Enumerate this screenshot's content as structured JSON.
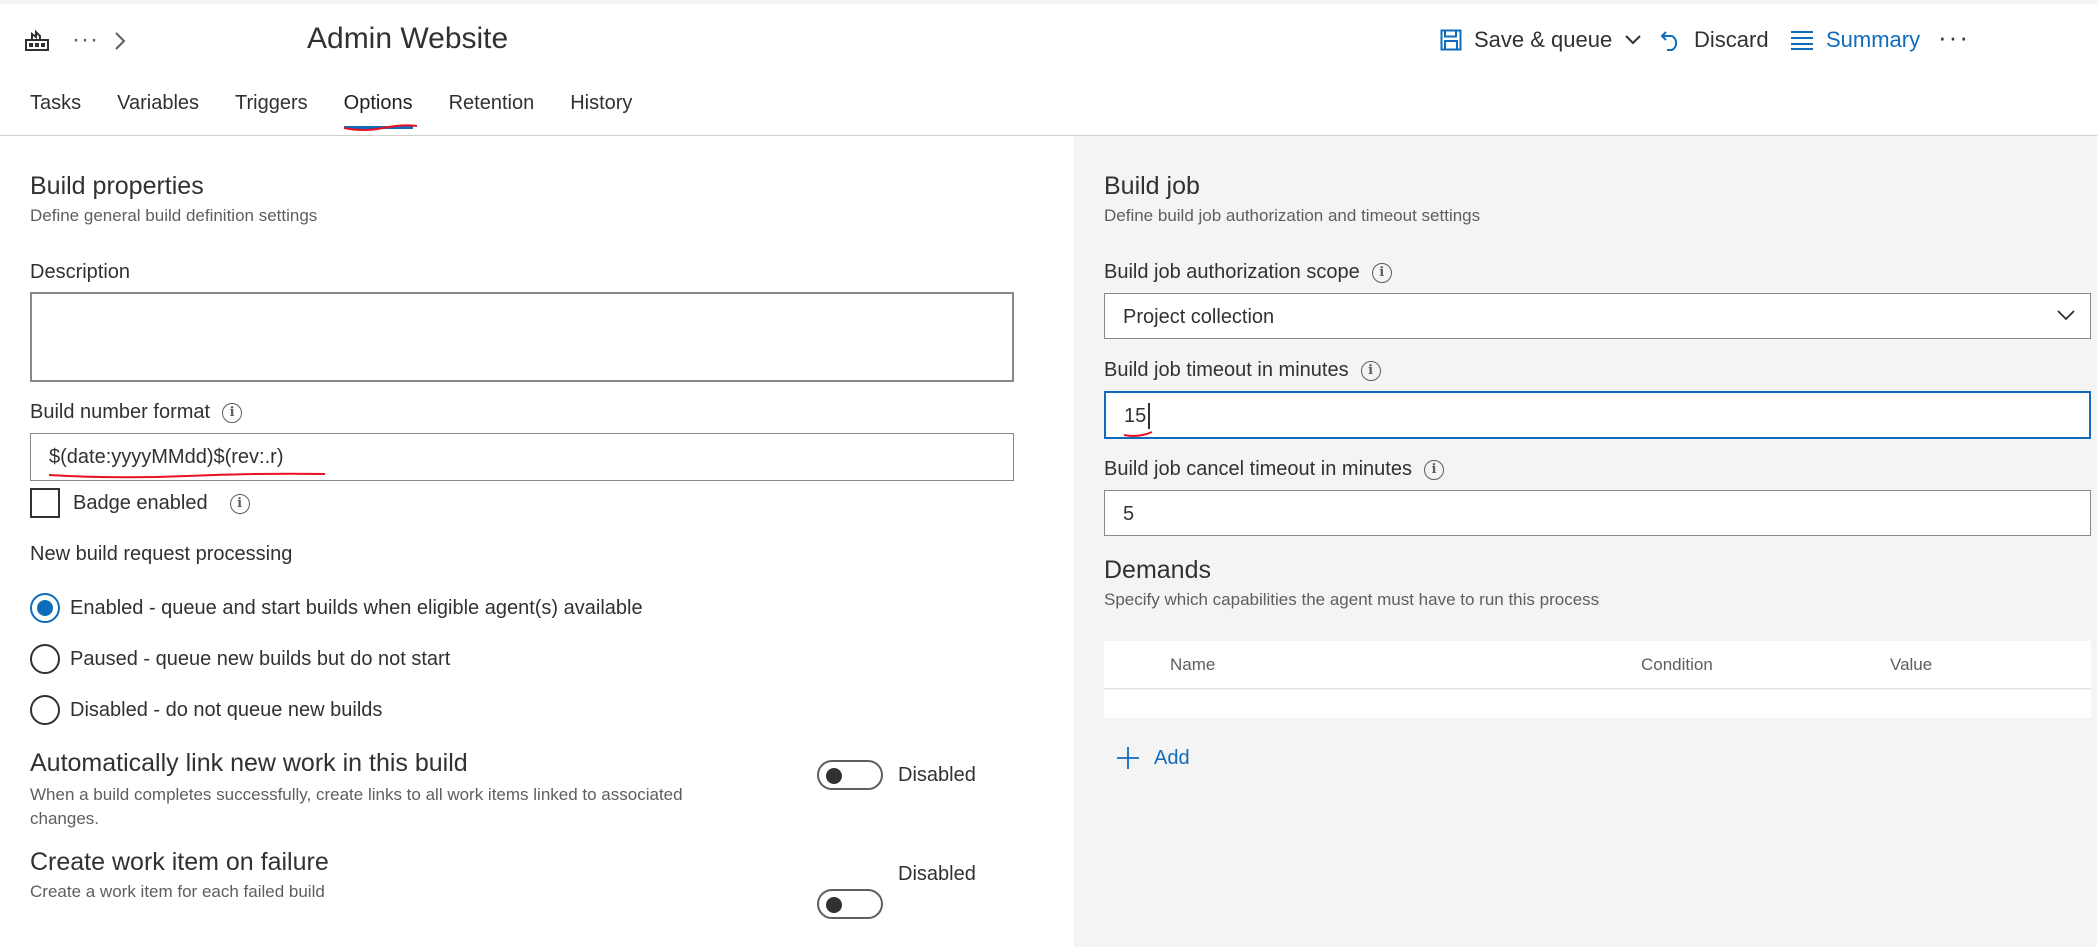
{
  "header": {
    "title": "Admin Website",
    "breadcrumb_more": "···",
    "save_queue_label": "Save & queue",
    "discard_label": "Discard",
    "summary_label": "Summary",
    "more_label": "···"
  },
  "tabs": [
    {
      "label": "Tasks",
      "active": false
    },
    {
      "label": "Variables",
      "active": false
    },
    {
      "label": "Triggers",
      "active": false
    },
    {
      "label": "Options",
      "active": true
    },
    {
      "label": "Retention",
      "active": false
    },
    {
      "label": "History",
      "active": false
    }
  ],
  "build_properties": {
    "title": "Build properties",
    "subtitle": "Define general build definition settings",
    "description_label": "Description",
    "description_value": "",
    "build_number_format_label": "Build number format",
    "build_number_format_value": "$(date:yyyyMMdd)$(rev:.r)",
    "badge_enabled_label": "Badge enabled",
    "badge_enabled": false,
    "new_request_label": "New build request processing",
    "radios": [
      {
        "label": "Enabled - queue and start builds when eligible agent(s) available",
        "checked": true
      },
      {
        "label": "Paused - queue new builds but do not start",
        "checked": false
      },
      {
        "label": "Disabled - do not queue new builds",
        "checked": false
      }
    ]
  },
  "auto_link": {
    "title": "Automatically link new work in this build",
    "description": "When a build completes successfully, create links to all work items linked to associated changes.",
    "toggle_label": "Disabled",
    "enabled": false
  },
  "work_item_failure": {
    "title": "Create work item on failure",
    "description": "Create a work item for each failed build",
    "toggle_label": "Disabled",
    "enabled": false
  },
  "build_job": {
    "title": "Build job",
    "subtitle": "Define build job authorization and timeout settings",
    "auth_scope_label": "Build job authorization scope",
    "auth_scope_value": "Project collection",
    "timeout_label": "Build job timeout in minutes",
    "timeout_value": "15",
    "cancel_timeout_label": "Build job cancel timeout in minutes",
    "cancel_timeout_value": "5"
  },
  "demands": {
    "title": "Demands",
    "subtitle": "Specify which capabilities the agent must have to run this process",
    "columns": [
      "Name",
      "Condition",
      "Value"
    ],
    "rows": [],
    "add_label": "Add"
  },
  "colors": {
    "accent": "#0f6cbd",
    "annotation_red": "#e81123",
    "panel_bg": "#f4f4f4"
  }
}
